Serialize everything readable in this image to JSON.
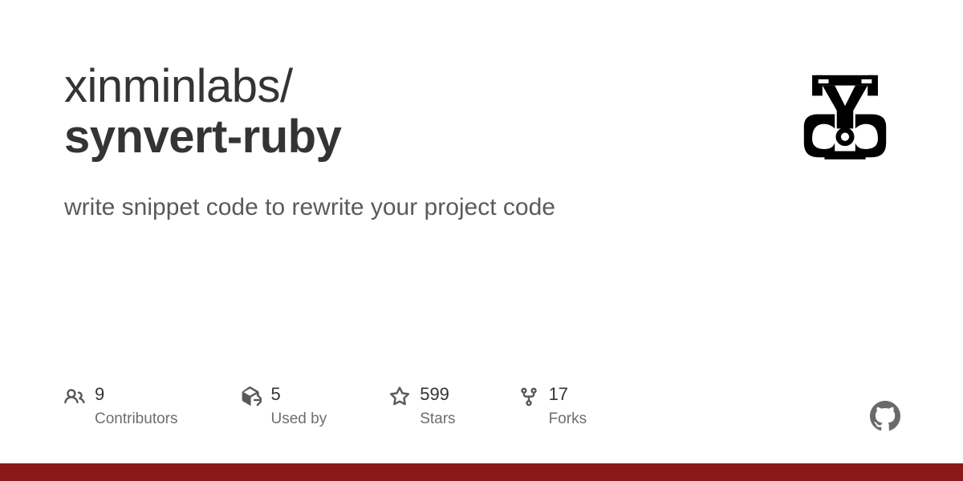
{
  "repo": {
    "owner": "xinminlabs",
    "name": "synvert-ruby",
    "description": "write snippet code to rewrite your project code"
  },
  "stats": {
    "contributors": {
      "value": "9",
      "label": "Contributors"
    },
    "used_by": {
      "value": "5",
      "label": "Used by"
    },
    "stars": {
      "value": "599",
      "label": "Stars"
    },
    "forks": {
      "value": "17",
      "label": "Forks"
    }
  },
  "colors": {
    "language_bar": "#8a1a1a"
  }
}
